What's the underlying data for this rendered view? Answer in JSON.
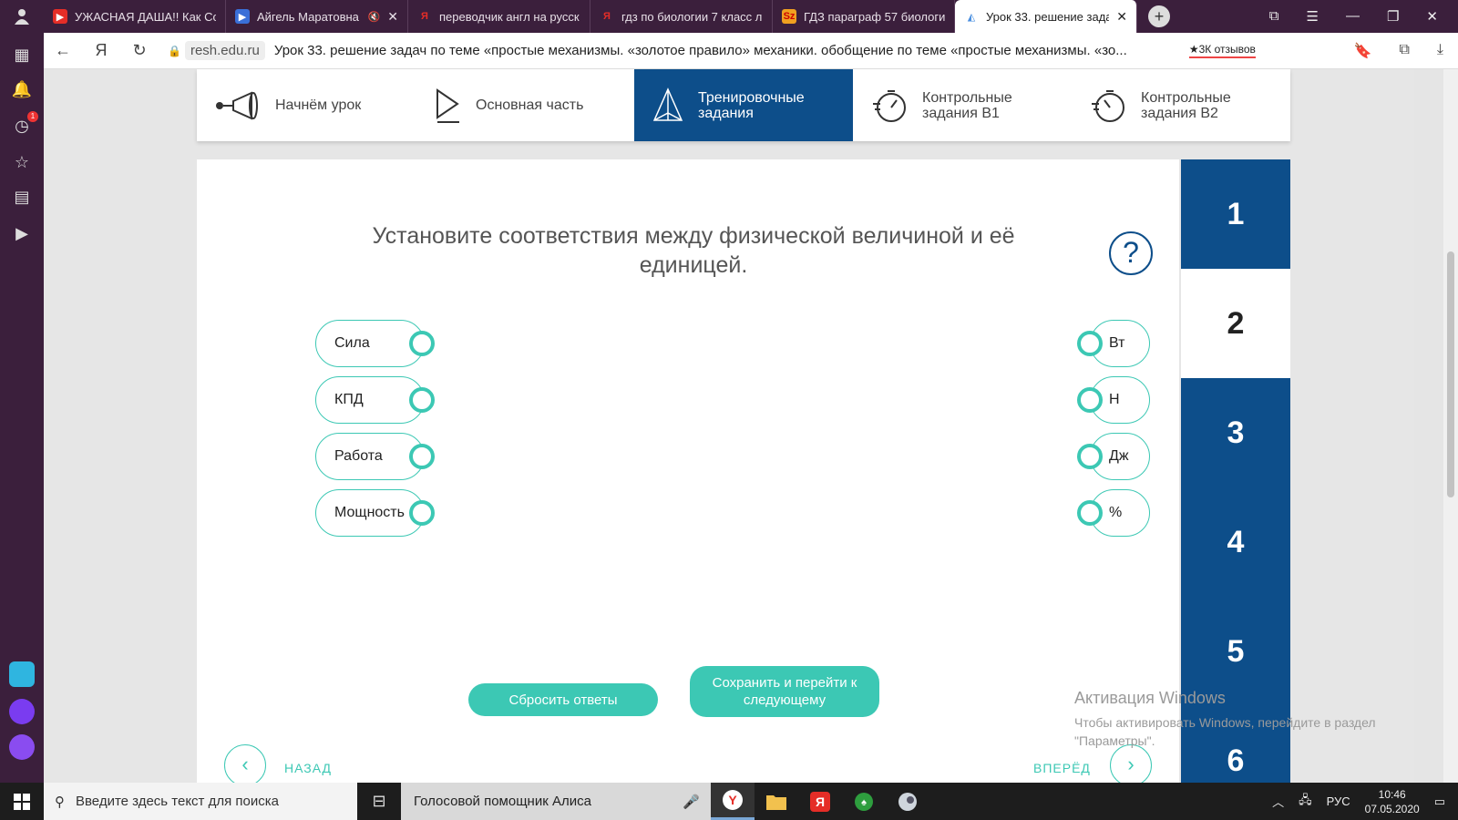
{
  "browser": {
    "tabs": [
      {
        "title": "УЖАСНАЯ ДАША!! Как Со",
        "icon": "youtube-icon",
        "color": "#e52d27"
      },
      {
        "title": "Айгель Маратовна",
        "icon": "video-icon",
        "color": "#3a6fd8"
      },
      {
        "title": "переводчик англ на русск",
        "icon": "yandex-icon",
        "color": "#e52d27"
      },
      {
        "title": "гдз по биологии 7 класс л",
        "icon": "yandex-icon",
        "color": "#e52d27"
      },
      {
        "title": "ГДЗ параграф 57 биологи",
        "icon": "gdz-icon",
        "color": "#f0a020"
      },
      {
        "title": "Урок 33. решение зада",
        "icon": "resh-icon",
        "color": "#4a8fe0"
      }
    ],
    "domain": "resh.edu.ru",
    "page_title": "Урок 33. решение задач по теме «простые механизмы. «золотое правило» механики. обобщение по теме «простые механизмы. «зо...",
    "reviews": "★3К отзывов"
  },
  "lesson_nav": [
    {
      "label": "Начнём урок",
      "icon": "megaphone-icon"
    },
    {
      "label": "Основная часть",
      "icon": "play-icon"
    },
    {
      "label": "Тренировочные задания",
      "icon": "pyramid-icon",
      "active": true
    },
    {
      "label": "Контрольные задания В1",
      "icon": "timer-icon"
    },
    {
      "label": "Контрольные задания В2",
      "icon": "timer-icon"
    }
  ],
  "task": {
    "question": "Установите соответствия между физической величиной и её единицей.",
    "help": "?",
    "left_items": [
      "Сила",
      "КПД",
      "Работа",
      "Мощность"
    ],
    "right_items": [
      "Вт",
      "Н",
      "Дж",
      "%"
    ],
    "reset_label": "Сбросить ответы",
    "save_label": "Сохранить и перейти к следующему",
    "back_label": "НАЗАД",
    "forward_label": "ВПЕРЁД"
  },
  "steps": {
    "items": [
      "1",
      "2",
      "3",
      "4",
      "5",
      "6"
    ],
    "current": "2"
  },
  "watermark": {
    "title": "Активация Windows",
    "subtitle": "Чтобы активировать Windows, перейдите в раздел \"Параметры\"."
  },
  "taskbar": {
    "search_placeholder": "Введите здесь текст для поиска",
    "alice_label": "Голосовой помощник Алиса",
    "lang": "РУС",
    "time": "10:46",
    "date": "07.05.2020"
  },
  "colors": {
    "accent": "#0d4e8a",
    "teal": "#3cc8b4",
    "browser_bg": "#3b1f3c"
  }
}
